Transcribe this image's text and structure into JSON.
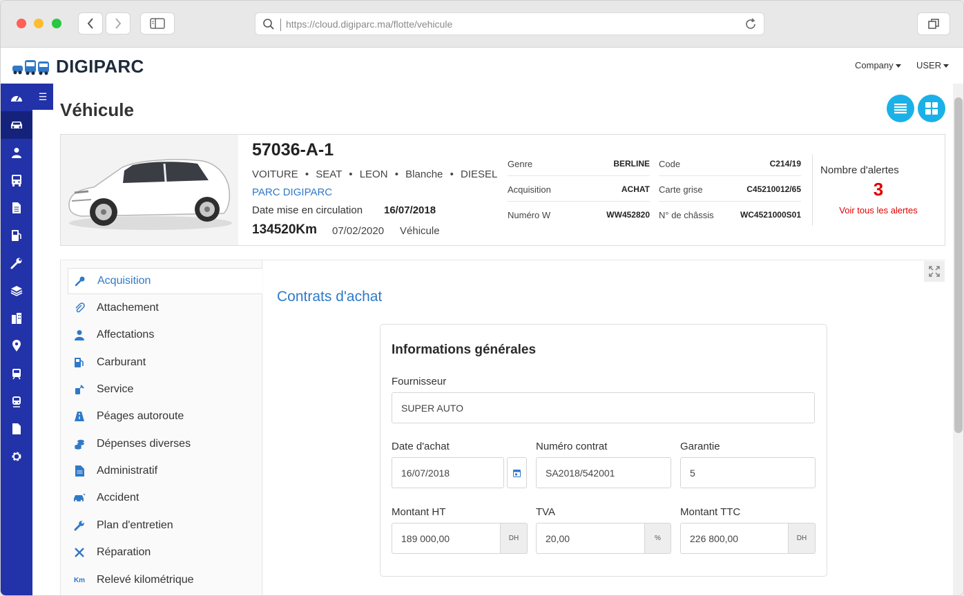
{
  "browser": {
    "url": "https://cloud.digiparc.ma/flotte/vehicule"
  },
  "app": {
    "brand": "DIGIPARC",
    "company_menu": "Company",
    "user_menu": "USER"
  },
  "sidebar": {
    "items": [
      "dashboard-icon",
      "car-icon",
      "user-icon",
      "bus-icon",
      "document-icon",
      "fuel-icon",
      "wrench-icon",
      "layers-icon",
      "building-icon",
      "location-icon",
      "tram-icon",
      "train-icon",
      "file-icon",
      "settings-icon"
    ],
    "toggle": "☰"
  },
  "page": {
    "title": "Véhicule"
  },
  "vehicle": {
    "plate": "57036-A-1",
    "type": "VOITURE",
    "brand": "SEAT",
    "model": "LEON",
    "color": "Blanche",
    "fuel": "DIESEL",
    "bullet": "•",
    "park": "PARC DIGIPARC",
    "circulation_label": "Date mise en circulation",
    "circulation_date": "16/07/2018",
    "km": "134520Km",
    "km_date": "07/02/2020",
    "km_source": "Véhicule",
    "info_left": [
      {
        "key": "Genre",
        "value": "BERLINE"
      },
      {
        "key": "Acquisition",
        "value": "ACHAT"
      },
      {
        "key": "Numéro W",
        "value": "WW452820"
      }
    ],
    "info_right": [
      {
        "key": "Code",
        "value": "C214/19"
      },
      {
        "key": "Carte grise",
        "value": "C45210012/65"
      },
      {
        "key": "N° de châssis",
        "value": "WC4521000S01"
      }
    ],
    "alerts_label": "Nombre d'alertes",
    "alerts_count": "3",
    "alerts_link": "Voir tous les alertes"
  },
  "menu": [
    {
      "label": "Acquisition",
      "icon": "key-icon",
      "active": true
    },
    {
      "label": "Attachement",
      "icon": "paperclip-icon"
    },
    {
      "label": "Affectations",
      "icon": "user-icon"
    },
    {
      "label": "Carburant",
      "icon": "fuel-icon"
    },
    {
      "label": "Service",
      "icon": "service-icon"
    },
    {
      "label": "Péages autoroute",
      "icon": "road-icon"
    },
    {
      "label": "Dépenses diverses",
      "icon": "coins-icon"
    },
    {
      "label": "Administratif",
      "icon": "document-icon"
    },
    {
      "label": "Accident",
      "icon": "car-crash-icon"
    },
    {
      "label": "Plan d'entretien",
      "icon": "wrench-icon"
    },
    {
      "label": "Réparation",
      "icon": "tools-icon"
    },
    {
      "label": "Relevé kilométrique",
      "icon": "km-icon",
      "icon_text": "Km"
    }
  ],
  "content": {
    "section_title": "Contrats d'achat",
    "form_title": "Informations générales",
    "fournisseur": {
      "label": "Fournisseur",
      "value": "SUPER AUTO"
    },
    "date_achat": {
      "label": "Date d'achat",
      "value": "16/07/2018"
    },
    "numero_contrat": {
      "label": "Numéro contrat",
      "value": "SA2018/542001"
    },
    "garantie": {
      "label": "Garantie",
      "value": "5"
    },
    "montant_ht": {
      "label": "Montant HT",
      "value": "189 000,00",
      "suffix": "DH"
    },
    "tva": {
      "label": "TVA",
      "value": "20,00",
      "suffix": "%"
    },
    "montant_ttc": {
      "label": "Montant TTC",
      "value": "226 800,00",
      "suffix": "DH"
    }
  },
  "colors": {
    "sidebar": "#2232a8",
    "accent": "#2f79c8",
    "alert": "#e00000",
    "round_button": "#1ab1e8"
  }
}
